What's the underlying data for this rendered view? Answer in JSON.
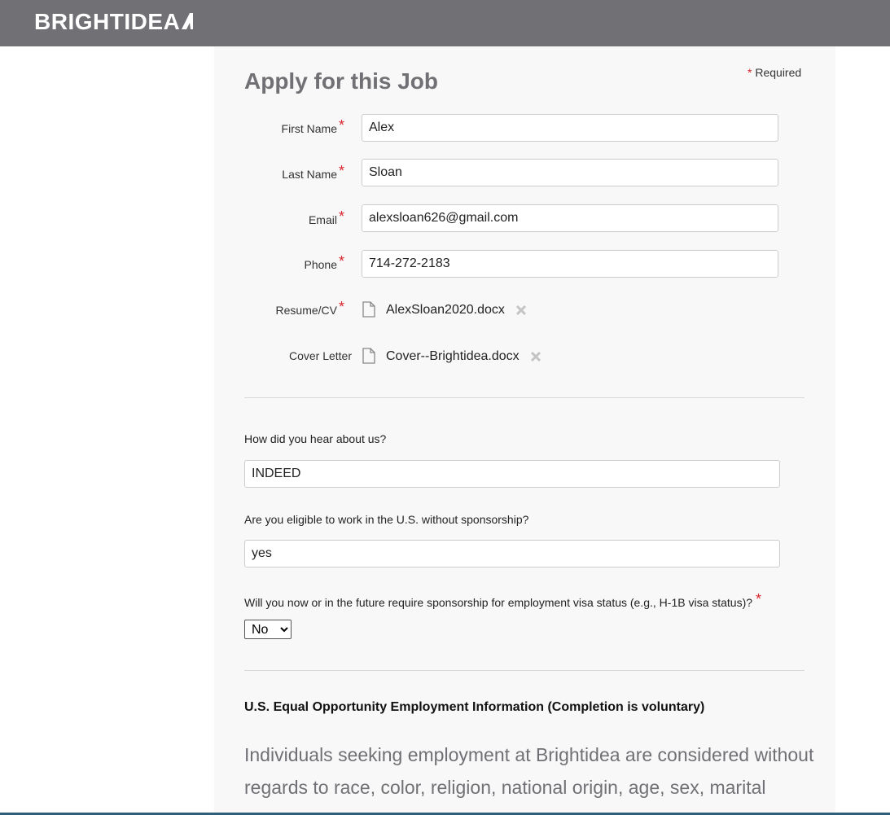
{
  "header": {
    "logo_text": "BRIGHTIDEA",
    "background": "#707075"
  },
  "form": {
    "required_note": "Required",
    "title": "Apply for this Job",
    "fields": {
      "first_name": {
        "label": "First Name",
        "value": "Alex"
      },
      "last_name": {
        "label": "Last Name",
        "value": "Sloan"
      },
      "email": {
        "label": "Email",
        "value": "alexsloan626@gmail.com"
      },
      "phone": {
        "label": "Phone",
        "value": "714-272-2183"
      },
      "resume": {
        "label": "Resume/CV",
        "file": "AlexSloan2020.docx"
      },
      "cover_letter": {
        "label": "Cover Letter",
        "file": "Cover--Brightidea.docx"
      }
    },
    "questions": {
      "hear_about": {
        "label": "How did you hear about us?",
        "value": "INDEED"
      },
      "eligible": {
        "label": "Are you eligible to work in the U.S. without sponsorship?",
        "value": "yes"
      },
      "sponsorship": {
        "label": "Will you now or in the future require sponsorship for employment visa status (e.g., H-1B visa status)?",
        "selected": "No"
      }
    },
    "eeo": {
      "title": "U.S. Equal Opportunity Employment Information (Completion is voluntary)",
      "body": "Individuals seeking employment at Brightidea are considered without regards to race, color, religion, national origin, age, sex, marital status, ancestry, physical or mental disability, veteran status, gender"
    }
  },
  "icons": {
    "file": "document-icon",
    "remove": "close-x-icon"
  },
  "colors": {
    "required_star": "#d9262c",
    "title_gray": "#707075"
  }
}
